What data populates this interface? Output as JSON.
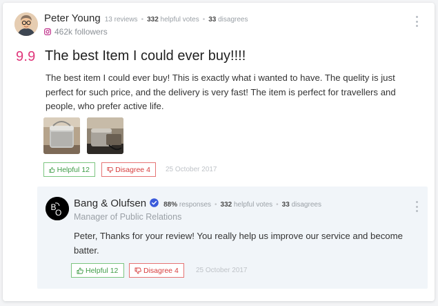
{
  "review": {
    "author": {
      "name": "Peter Young",
      "reviews_label": "13 reviews",
      "helpful_votes_num": "332",
      "helpful_votes_label": "helpful votes",
      "disagrees_num": "33",
      "disagrees_label": "disagrees",
      "followers": "462k followers",
      "avatar": "user-avatar",
      "social_icon": "instagram-icon"
    },
    "score": "9.9",
    "title": "The best Item I could ever buy!!!!",
    "body": "The best item I could ever buy! This is exactly what i wanted to have. The quelity is just perfect for such price, and the delivery is very fast! The item is perfect for travellers and people, who prefer active life.",
    "photos": [
      "product-photo-speaker",
      "product-photo-speaker-side"
    ],
    "actions": {
      "helpful_label": "Helpful",
      "helpful_count": "12",
      "disagree_label": "Disagree",
      "disagree_count": "4",
      "date": "25 October 2017"
    },
    "menu_icon": "more-vertical-icon"
  },
  "reply": {
    "brand": {
      "name": "Bang & Olufsen",
      "logo": "bang-olufsen-logo",
      "verified_icon": "verified-badge-icon",
      "responses_num": "88%",
      "responses_label": "responses",
      "helpful_votes_num": "332",
      "helpful_votes_label": "helpful votes",
      "disagrees_num": "33",
      "disagrees_label": "disagrees",
      "role": "Manager of Public Relations"
    },
    "body": "Peter, Thanks for your review! You really help us improve our service and become batter.",
    "actions": {
      "helpful_label": "Helpful",
      "helpful_count": "12",
      "disagree_label": "Disagree",
      "disagree_count": "4",
      "date": "25 October 2017"
    },
    "menu_icon": "more-vertical-icon"
  },
  "colors": {
    "score": "#e0357a",
    "helpful": "#3d9b45",
    "disagree": "#d63b3b",
    "verified": "#3b5bdb",
    "reply_background": "#f1f5f9"
  }
}
